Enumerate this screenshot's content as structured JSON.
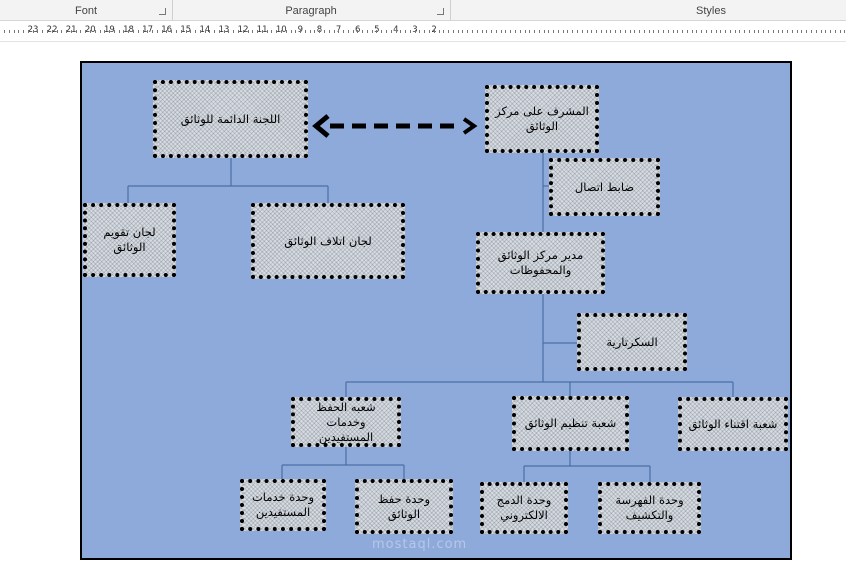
{
  "ribbon": {
    "groups": [
      "Font",
      "Paragraph",
      "Styles"
    ]
  },
  "ruler": {
    "numbers": [
      "23",
      "22",
      "21",
      "20",
      "19",
      "18",
      "17",
      "16",
      "15",
      "14",
      "13",
      "12",
      "11",
      "10",
      "9",
      "8",
      "7",
      "6",
      "5",
      "4",
      "3",
      "2"
    ]
  },
  "diagram": {
    "nodes": {
      "permanent_committee": "اللجنة الدائمة للوثائق",
      "center_supervisor": "المشرف على مركز الوثائق",
      "liaison_officer": "ضابط اتصال",
      "evaluation_committees": "لجان تقويم الوثائق",
      "destruction_committees": "لجان اتلاف الوثائق",
      "center_director": "مدير مركز الوثائق والمحفوظات",
      "secretariat": "السكرتارية",
      "preservation_section": "شعبه الحفظ وخدمات المستفيدين",
      "organization_section": "شعبة تنظيم الوثائق",
      "acquisition_section": "شعبة اقتناء الوثائق",
      "beneficiary_services_unit": "وحدة خدمات المستفيدين",
      "document_preservation_unit": "وحدة حفظ الوثائق",
      "electronic_merge_unit": "وحدة الدمج الالكتروني",
      "indexing_unit": "وحدة الفهرسة والتكشيف"
    }
  },
  "watermark": "mostaql.com"
}
